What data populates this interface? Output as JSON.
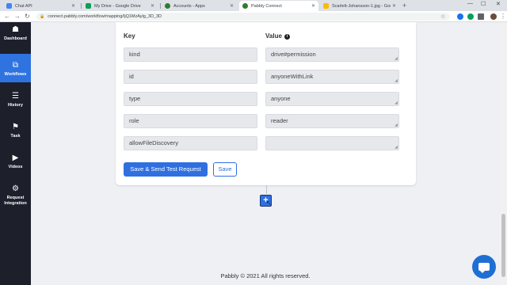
{
  "browser": {
    "tabs": [
      {
        "label": "Chat API",
        "color": "#4285f4"
      },
      {
        "label": "My Drive - Google Drive",
        "color": "#0f9d58"
      },
      {
        "label": "Accounts - Apps",
        "color": "#2e7d32"
      },
      {
        "label": "Pabbly Connect",
        "color": "#2e7d32"
      },
      {
        "label": "Scarlett-Johansson-1.jpg - Goog",
        "color": "#fbbc04"
      }
    ],
    "url": "connect.pabbly.com/workflow/mapping/IjQ1MzAylg_3D_3D"
  },
  "sidebar": {
    "items": [
      {
        "label": "Dashboard",
        "icon": "dashboard-icon",
        "glyph": "☗"
      },
      {
        "label": "Workflows",
        "icon": "workflow-icon",
        "glyph": "⧉"
      },
      {
        "label": "History",
        "icon": "history-list-icon",
        "glyph": "☰"
      },
      {
        "label": "Task",
        "icon": "task-icon",
        "glyph": "⚑"
      },
      {
        "label": "Videos",
        "icon": "play-icon",
        "glyph": "▶"
      },
      {
        "label": "Request Integration",
        "icon": "gears-icon",
        "glyph": "⚙"
      }
    ]
  },
  "mapping": {
    "key_header": "Key",
    "value_header": "Value",
    "rows": [
      {
        "key": "kind",
        "value": "drive#permission"
      },
      {
        "key": "id",
        "value": "anyoneWithLink"
      },
      {
        "key": "type",
        "value": "anyone"
      },
      {
        "key": "role",
        "value": "reader"
      },
      {
        "key": "allowFileDiscovery",
        "value": ""
      }
    ],
    "save_test_label": "Save & Send Test Request",
    "save_label": "Save"
  },
  "add_step_glyph": "+",
  "footer": "Pabbly © 2021 All rights reserved.",
  "colors": {
    "accent": "#2f6fe0",
    "sidebar_bg": "#1d1f2b",
    "active_item": "#2f73e0"
  }
}
